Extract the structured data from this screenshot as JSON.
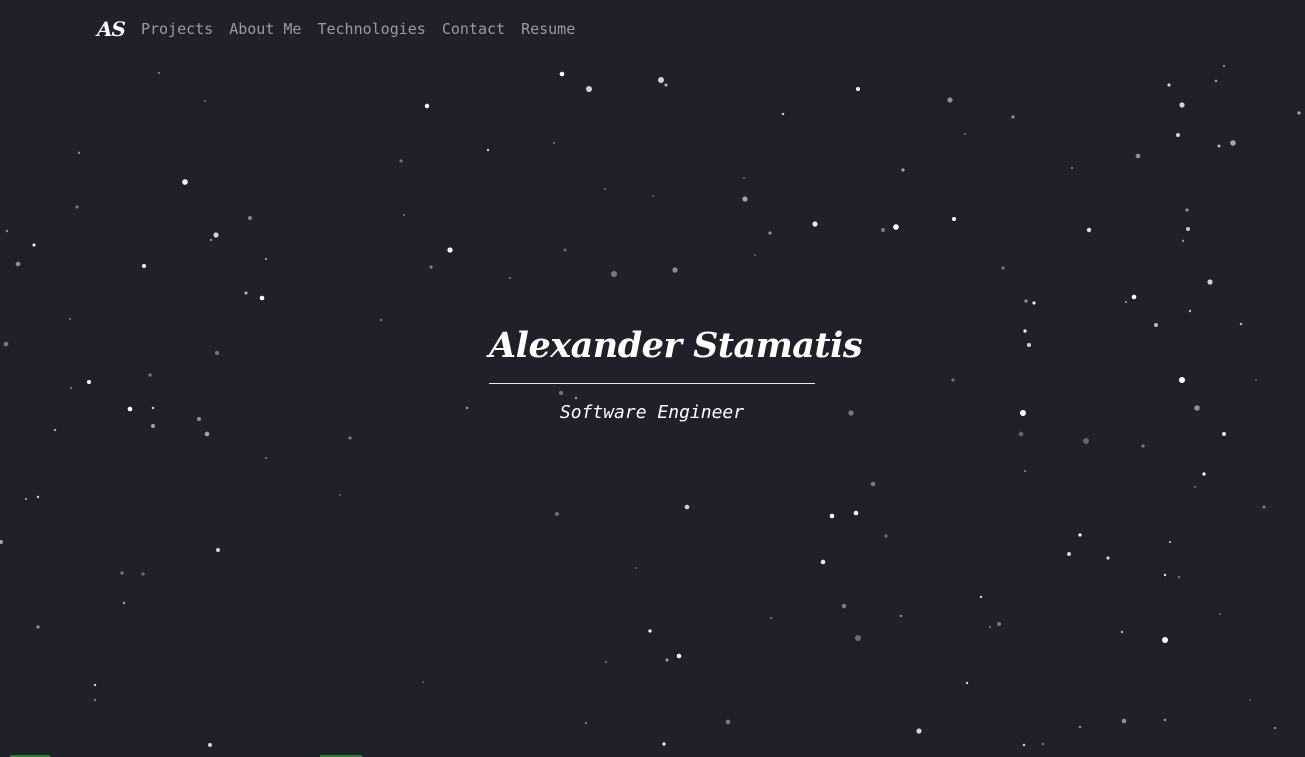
{
  "nav": {
    "logo": "AS",
    "links": [
      "Projects",
      "About Me",
      "Technologies",
      "Contact",
      "Resume"
    ]
  },
  "hero": {
    "name": "Alexander Stamatis",
    "title": "Software Engineer"
  },
  "colors": {
    "background": "#1f2029",
    "nav_text": "#9a9a9e",
    "text": "#ffffff",
    "accent": "#2e7d32"
  }
}
